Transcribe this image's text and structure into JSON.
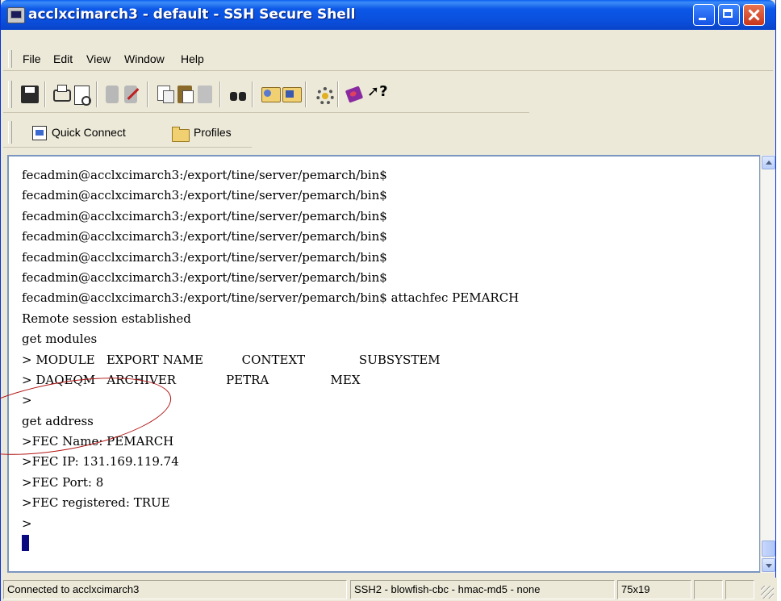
{
  "window": {
    "title": "acclxcimarch3 - default - SSH Secure Shell"
  },
  "menu": {
    "items": [
      "File",
      "Edit",
      "View",
      "Window",
      "Help"
    ]
  },
  "toolbar": {
    "icons": [
      "save-icon",
      "print-icon",
      "print-preview-icon",
      "disconnect-icon",
      "disconnect-disabled-icon",
      "copy-icon",
      "paste-icon",
      "paste-special-icon",
      "find-icon",
      "file-transfer-icon",
      "new-window-icon",
      "settings-icon",
      "help-book-icon",
      "context-help-icon"
    ]
  },
  "quickbar": {
    "quick_connect": "Quick Connect",
    "profiles": "Profiles"
  },
  "terminal": {
    "lines": [
      "fecadmin@acclxcimarch3:/export/tine/server/pemarch/bin$",
      "fecadmin@acclxcimarch3:/export/tine/server/pemarch/bin$",
      "fecadmin@acclxcimarch3:/export/tine/server/pemarch/bin$",
      "fecadmin@acclxcimarch3:/export/tine/server/pemarch/bin$",
      "fecadmin@acclxcimarch3:/export/tine/server/pemarch/bin$",
      "fecadmin@acclxcimarch3:/export/tine/server/pemarch/bin$",
      "fecadmin@acclxcimarch3:/export/tine/server/pemarch/bin$ attachfec PEMARCH",
      "Remote session established",
      "get modules",
      "> MODULE   EXPORT NAME          CONTEXT              SUBSYSTEM",
      "> DAQEQM   ARCHIVER             PETRA                MEX",
      ">",
      "get address",
      ">FEC Name: PEMARCH",
      ">FEC IP: 131.169.119.74",
      ">FEC Port: 8",
      ">FEC registered: TRUE",
      ">"
    ]
  },
  "status": {
    "connection": "Connected to acclxcimarch3",
    "cipher": "SSH2 - blowfish-cbc - hmac-md5 - none",
    "size": "75x19"
  }
}
